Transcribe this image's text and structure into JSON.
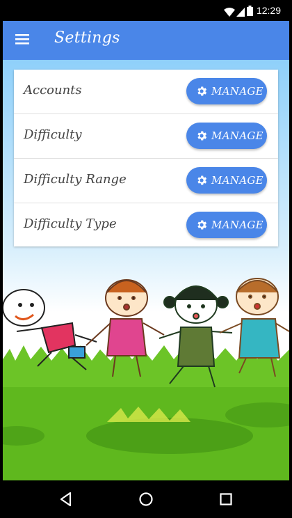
{
  "status_bar": {
    "time": "12:29",
    "icons": [
      "wifi-icon",
      "cell-signal-icon",
      "battery-icon"
    ]
  },
  "app_bar": {
    "title": "Settings",
    "menu_icon": "hamburger-menu-icon"
  },
  "settings": {
    "items": [
      {
        "label": "Accounts",
        "button": "MANAGE"
      },
      {
        "label": "Difficulty",
        "button": "MANAGE"
      },
      {
        "label": "Difficulty Range",
        "button": "MANAGE"
      },
      {
        "label": "Difficulty Type",
        "button": "MANAGE"
      }
    ]
  },
  "nav_bar": {
    "icons": [
      "back-icon",
      "home-icon",
      "recents-icon"
    ]
  },
  "colors": {
    "primary": "#4a86e8",
    "sky": "#bfe4fb",
    "grass": "#5fb81e"
  }
}
